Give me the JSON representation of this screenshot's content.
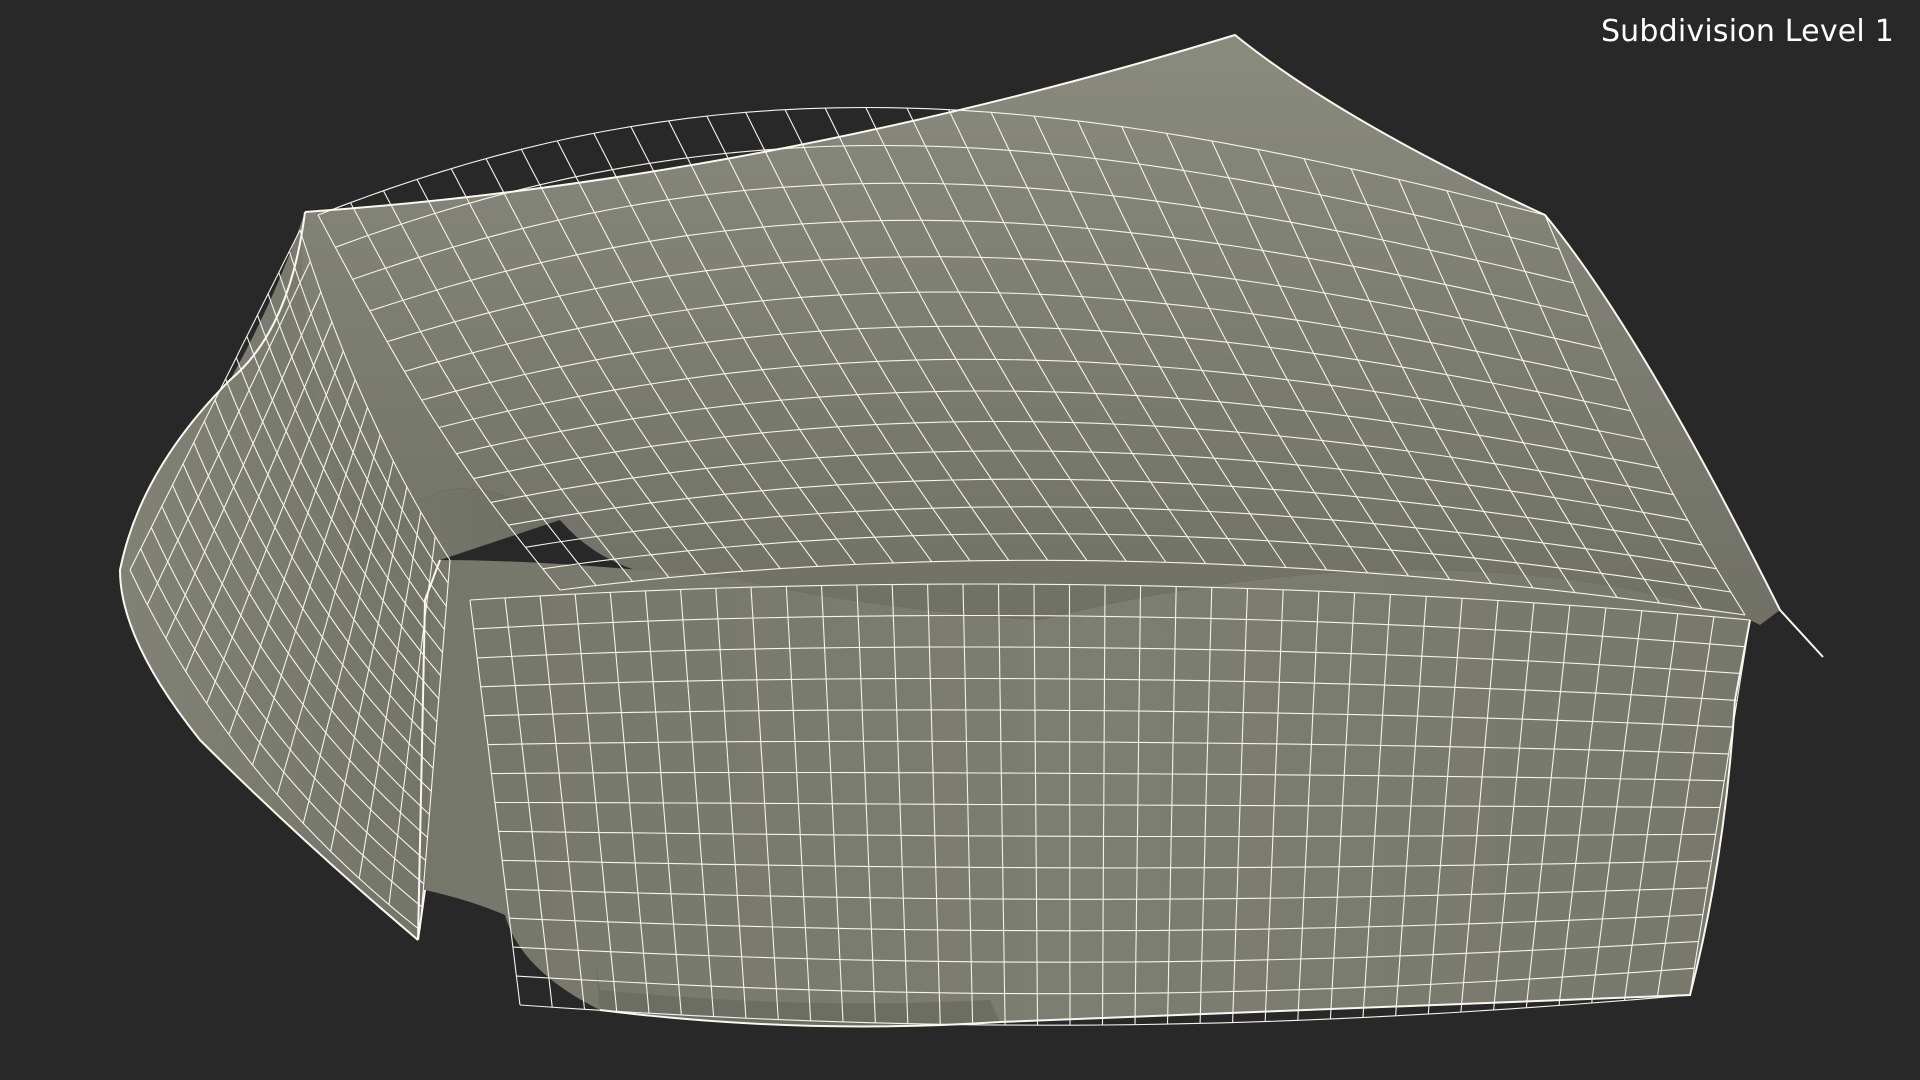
{
  "viewport": {
    "label": "Subdivision Level 1",
    "background_color": "#282828",
    "mesh_fill_color": "#7a7b6f",
    "wire_color": "#f4f4ea",
    "display_mode": "wireframe-on-shaded"
  }
}
